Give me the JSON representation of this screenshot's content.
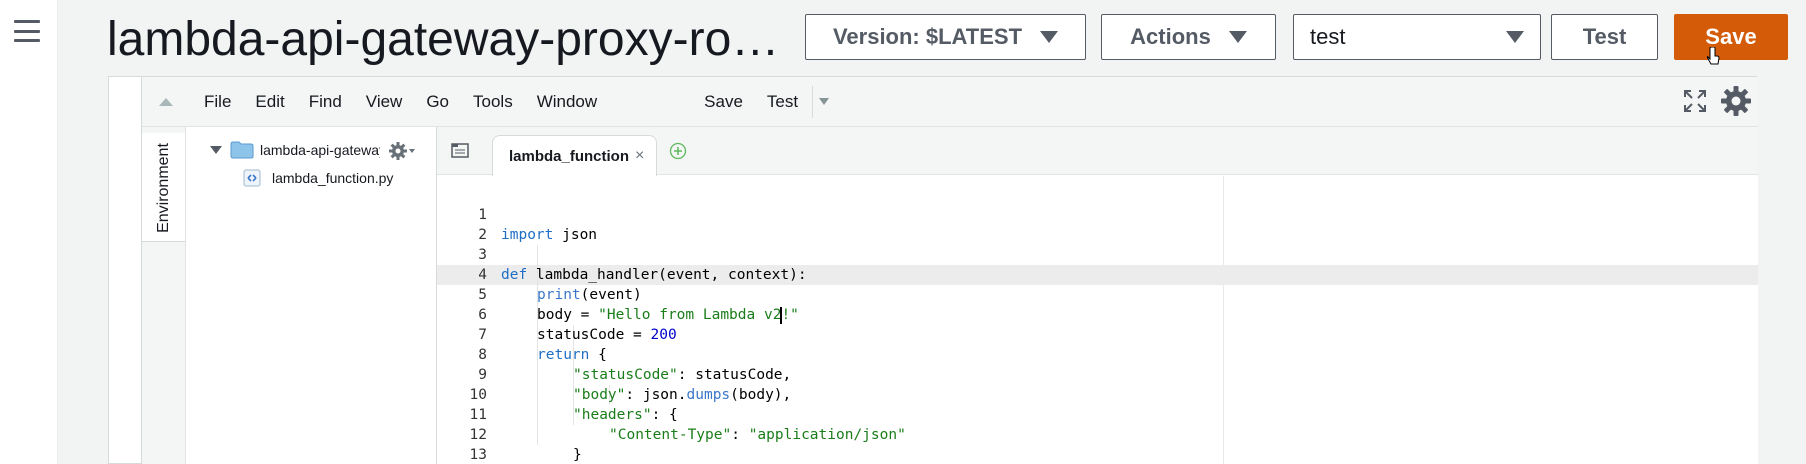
{
  "header": {
    "function_name": "lambda-api-gateway-proxy-root...",
    "version_label": "Version: $LATEST",
    "actions_label": "Actions",
    "test_event_selected": "test",
    "test_label": "Test",
    "save_label": "Save"
  },
  "ide": {
    "menu": [
      "File",
      "Edit",
      "Find",
      "View",
      "Go",
      "Tools",
      "Window"
    ],
    "toolbar_save": "Save",
    "toolbar_test": "Test",
    "environment_label": "Environment",
    "tree": {
      "root_folder": "lambda-api-gateway",
      "file": "lambda_function.py"
    },
    "active_tab": "lambda_function",
    "tab_close": "×"
  },
  "code": {
    "line_numbers": [
      "1",
      "2",
      "3",
      "4",
      "5",
      "6",
      "7",
      "8",
      "9",
      "10",
      "11",
      "12",
      "13"
    ],
    "l1_kw": "import",
    "l1_rest": " json",
    "l3_kw": "def",
    "l3_rest": " lambda_handler(event, context):",
    "l4_fn": "print",
    "l4_rest": "(event)",
    "l5_a": "body = ",
    "l5_str_a": "\"Hello from Lambda v2",
    "l5_str_b": "!\"",
    "l6_a": "statusCode = ",
    "l6_num": "200",
    "l7_kw": "return",
    "l7_rest": " {",
    "l8_str": "\"statusCode\"",
    "l8_rest": ": statusCode,",
    "l9_str": "\"body\"",
    "l9_a": ": json.",
    "l9_fn": "dumps",
    "l9_rest": "(body),",
    "l10_str": "\"headers\"",
    "l10_rest": ": {",
    "l11_str_a": "\"Content-Type\"",
    "l11_mid": ": ",
    "l11_str_b": "\"application/json\"",
    "l12": "}",
    "l13": "}"
  },
  "colors": {
    "save_button": "#d45b07",
    "keyword": "#1f6fc5",
    "string": "#1a7d1a",
    "number": "#0000cd"
  }
}
